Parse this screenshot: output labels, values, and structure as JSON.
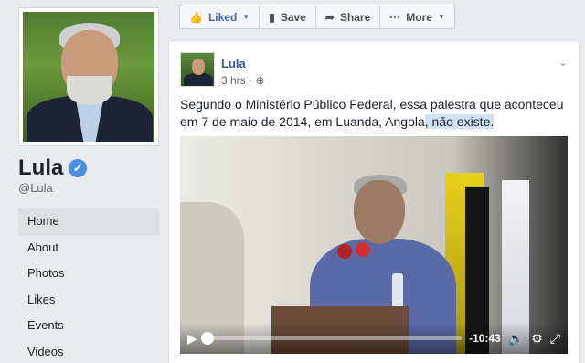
{
  "page": {
    "name": "Lula",
    "handle": "@Lula",
    "verified_icon": "✓"
  },
  "nav": {
    "items": [
      {
        "label": "Home",
        "active": true
      },
      {
        "label": "About"
      },
      {
        "label": "Photos"
      },
      {
        "label": "Likes"
      },
      {
        "label": "Events"
      },
      {
        "label": "Videos"
      }
    ]
  },
  "actions": {
    "liked": "Liked",
    "save": "Save",
    "share": "Share",
    "more": "More",
    "liked_icon": "👍",
    "save_icon": "▮",
    "share_icon": "➦",
    "more_icon": "···",
    "caret": "▼"
  },
  "post": {
    "author": "Lula",
    "time": "3 hrs · ",
    "privacy_icon": "⊕",
    "chevron": "⌄",
    "text_before": "Segundo o Ministério Público Federal, essa palestra que aconteceu em 7 de maio de 2014, em Luanda, Angola",
    "text_highlight": ", não existe.",
    "video": {
      "time_remaining": "-10:43",
      "play_icon": "▶",
      "volume_icon": "🔊",
      "settings_icon": "⚙",
      "fullscreen_icon": "⤢",
      "progress": 0.0
    }
  }
}
